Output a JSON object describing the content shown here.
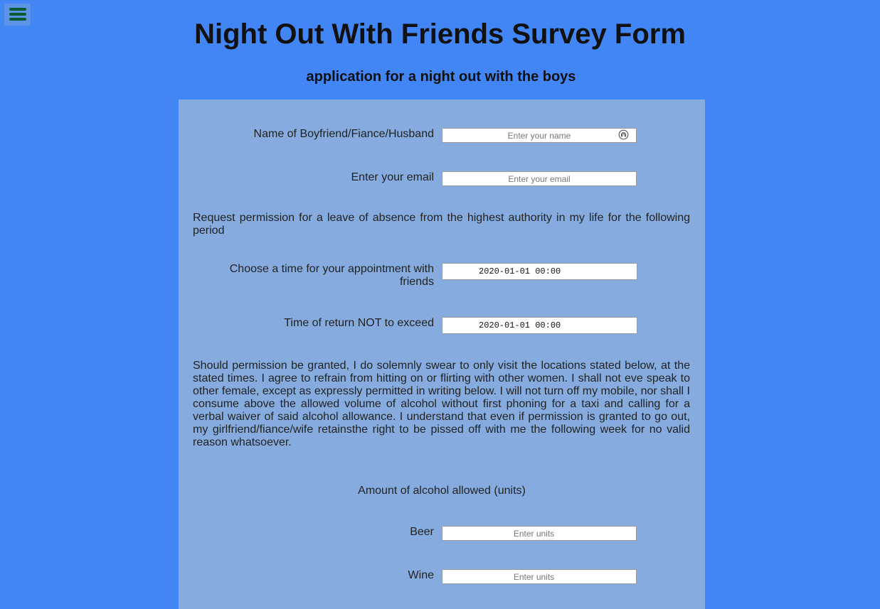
{
  "header": {
    "title": "Night Out With Friends Survey Form",
    "subtitle": "application for a night out with the boys"
  },
  "form": {
    "name_label": "Name of Boyfriend/Fiance/Husband",
    "name_placeholder": "Enter your name",
    "email_label": "Enter your email",
    "email_placeholder": "Enter your email",
    "request_text": "Request permission for a leave of absence from the highest authority in my life for the following period",
    "appointment_label": "Choose a time for your appointment with friends",
    "appointment_value": "2020-01-01 00:00",
    "return_label": "Time of return NOT to exceed",
    "return_value": "2020-01-01 00:00",
    "oath_text": "Should permission be granted, I do solemnly swear to only visit the locations stated below, at the stated times. I agree to refrain from hitting on or flirting with other women. I shall not eve speak to other female, except as expressly permitted in writing below. I will not turn off my mobile, nor shall I consume above the allowed volume of alcohol without first phoning for a taxi and calling for a verbal waiver of said alcohol allowance. I understand that even if permission is granted to go out, my girlfriend/fiance/wife retainsthe right to be pissed off with me the following week for no valid reason whatsoever.",
    "alcohol_heading": "Amount of alcohol allowed (units)",
    "beer_label": "Beer",
    "beer_placeholder": "Enter units",
    "wine_label": "Wine",
    "wine_placeholder": "Enter units"
  },
  "icons": {
    "menu": "hamburger-menu-icon",
    "autofill": "autofill-contact-icon"
  },
  "colors": {
    "page_background": "#4285f4",
    "panel_background": "#86acdf",
    "menu_bars": "#0a5a2f"
  }
}
